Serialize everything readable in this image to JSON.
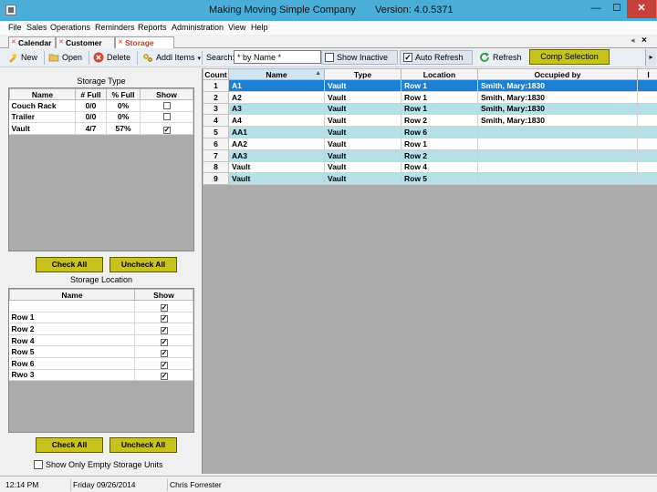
{
  "window": {
    "title": "Making Moving Simple Company",
    "version": "Version: 4.0.5371",
    "minimize": "—",
    "maximize": "☐",
    "close": "✕"
  },
  "menu": [
    "File",
    "Sales",
    "Operations",
    "Reminders",
    "Reports",
    "Administration",
    "View",
    "Help"
  ],
  "tabs": [
    {
      "label": "Calendar",
      "active": false
    },
    {
      "label": "Customer List",
      "active": false
    },
    {
      "label": "Storage Units",
      "active": true
    }
  ],
  "tabs_close": "×",
  "toolbar": {
    "new_label": "New",
    "open_label": "Open",
    "delete_label": "Delete",
    "addl_items_label": "Addl Items",
    "search_label": "Search:",
    "search_value": "* by Name *",
    "show_inactive_label": "Show Inactive",
    "show_inactive_checked": false,
    "auto_refresh_label": "Auto Refresh",
    "auto_refresh_checked": true,
    "refresh_label": "Refresh",
    "comp_selection_label": "Comp Selection"
  },
  "storage_type": {
    "title": "Storage Type",
    "columns": [
      "Name",
      "# Full",
      "% Full",
      "Show"
    ],
    "rows": [
      {
        "name": "Couch Rack",
        "full": "0/0",
        "pct": "0%",
        "show": false
      },
      {
        "name": "Trailer",
        "full": "0/0",
        "pct": "0%",
        "show": false
      },
      {
        "name": "Vault",
        "full": "4/7",
        "pct": "57%",
        "show": true
      }
    ],
    "check_all_label": "Check All",
    "uncheck_all_label": "Uncheck All"
  },
  "storage_location": {
    "title": "Storage Location",
    "columns": [
      "Name",
      "Show"
    ],
    "rows": [
      {
        "name": "",
        "show": true
      },
      {
        "name": "Row 1",
        "show": true
      },
      {
        "name": "Row 2",
        "show": true
      },
      {
        "name": "Row 4",
        "show": true
      },
      {
        "name": "Row 5",
        "show": true
      },
      {
        "name": "Row 6",
        "show": true
      },
      {
        "name": "Rwo 3",
        "show": true
      }
    ],
    "check_all_label": "Check All",
    "uncheck_all_label": "Uncheck All"
  },
  "show_only_empty_label": "Show Only Empty Storage Units",
  "show_only_empty_checked": false,
  "units_grid": {
    "columns": [
      "Count",
      "Name",
      "Type",
      "Location",
      "Occupied by",
      "I"
    ],
    "sorted_column": "Name",
    "rows": [
      {
        "count": "1",
        "name": "A1",
        "type": "Vault",
        "location": "Row 1",
        "occupied": "Smith, Mary:1830",
        "selected": true
      },
      {
        "count": "2",
        "name": "A2",
        "type": "Vault",
        "location": "Row 1",
        "occupied": "Smith, Mary:1830",
        "selected": false
      },
      {
        "count": "3",
        "name": "A3",
        "type": "Vault",
        "location": "Row 1",
        "occupied": "Smith, Mary:1830",
        "selected": false
      },
      {
        "count": "4",
        "name": "A4",
        "type": "Vault",
        "location": "Row 2",
        "occupied": "Smith, Mary:1830",
        "selected": false
      },
      {
        "count": "5",
        "name": "AA1",
        "type": "Vault",
        "location": "Row 6",
        "occupied": "",
        "selected": false
      },
      {
        "count": "6",
        "name": "AA2",
        "type": "Vault",
        "location": "Row 1",
        "occupied": "",
        "selected": false
      },
      {
        "count": "7",
        "name": "AA3",
        "type": "Vault",
        "location": "Row 2",
        "occupied": "",
        "selected": false
      },
      {
        "count": "8",
        "name": "Vault",
        "type": "Vault",
        "location": "Row 4",
        "occupied": "",
        "selected": false
      },
      {
        "count": "9",
        "name": "Vault",
        "type": "Vault",
        "location": "Row 5",
        "occupied": "",
        "selected": false
      }
    ]
  },
  "status": {
    "time": "12:14 PM",
    "date": "Friday 09/26/2014",
    "user": "Chris Forrester"
  },
  "colors": {
    "titlebar": "#4aaed8",
    "olive_button": "#c7c31a",
    "row_alt": "#b4e0e6",
    "row_selected": "#1e80d4",
    "close_button": "#c8403b"
  }
}
